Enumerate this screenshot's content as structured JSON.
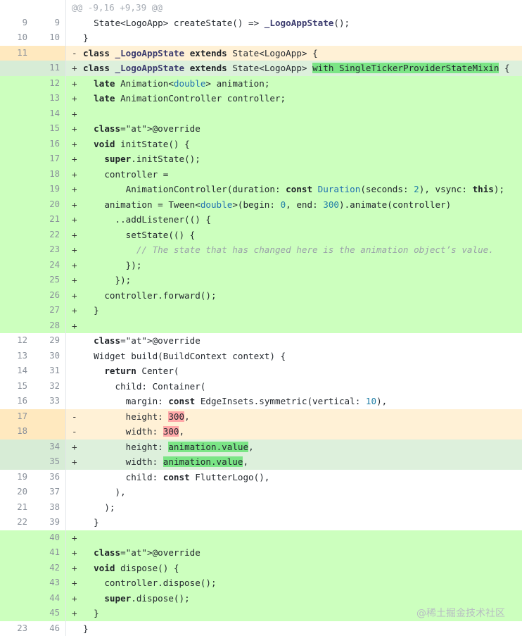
{
  "hunk_header": "@@ -9,16 +9,39 @@",
  "lines": [
    {
      "old": "9",
      "new": "9",
      "sign": "",
      "code": "  State<LogoApp> createState() => _LogoAppState();"
    },
    {
      "old": "10",
      "new": "10",
      "sign": "",
      "code": "}"
    },
    {
      "old": "11",
      "new": "",
      "sign": "-",
      "code": "class _LogoAppState extends State<LogoApp> {"
    },
    {
      "old": "",
      "new": "11",
      "sign": "+",
      "code": "class _LogoAppState extends State<LogoApp> with SingleTickerProviderStateMixin {"
    },
    {
      "old": "",
      "new": "12",
      "sign": "+",
      "code": "  late Animation<double> animation;"
    },
    {
      "old": "",
      "new": "13",
      "sign": "+",
      "code": "  late AnimationController controller;"
    },
    {
      "old": "",
      "new": "14",
      "sign": "+",
      "code": ""
    },
    {
      "old": "",
      "new": "15",
      "sign": "+",
      "code": "  @override"
    },
    {
      "old": "",
      "new": "16",
      "sign": "+",
      "code": "  void initState() {"
    },
    {
      "old": "",
      "new": "17",
      "sign": "+",
      "code": "    super.initState();"
    },
    {
      "old": "",
      "new": "18",
      "sign": "+",
      "code": "    controller ="
    },
    {
      "old": "",
      "new": "19",
      "sign": "+",
      "code": "        AnimationController(duration: const Duration(seconds: 2), vsync: this);"
    },
    {
      "old": "",
      "new": "20",
      "sign": "+",
      "code": "    animation = Tween<double>(begin: 0, end: 300).animate(controller)"
    },
    {
      "old": "",
      "new": "21",
      "sign": "+",
      "code": "      ..addListener(() {"
    },
    {
      "old": "",
      "new": "22",
      "sign": "+",
      "code": "        setState(() {"
    },
    {
      "old": "",
      "new": "23",
      "sign": "+",
      "code": "          // The state that has changed here is the animation object’s value."
    },
    {
      "old": "",
      "new": "24",
      "sign": "+",
      "code": "        });"
    },
    {
      "old": "",
      "new": "25",
      "sign": "+",
      "code": "      });"
    },
    {
      "old": "",
      "new": "26",
      "sign": "+",
      "code": "    controller.forward();"
    },
    {
      "old": "",
      "new": "27",
      "sign": "+",
      "code": "  }"
    },
    {
      "old": "",
      "new": "28",
      "sign": "+",
      "code": ""
    },
    {
      "old": "12",
      "new": "29",
      "sign": "",
      "code": "  @override"
    },
    {
      "old": "13",
      "new": "30",
      "sign": "",
      "code": "  Widget build(BuildContext context) {"
    },
    {
      "old": "14",
      "new": "31",
      "sign": "",
      "code": "    return Center("
    },
    {
      "old": "15",
      "new": "32",
      "sign": "",
      "code": "      child: Container("
    },
    {
      "old": "16",
      "new": "33",
      "sign": "",
      "code": "        margin: const EdgeInsets.symmetric(vertical: 10),"
    },
    {
      "old": "17",
      "new": "",
      "sign": "-",
      "code": "        height: 300,"
    },
    {
      "old": "18",
      "new": "",
      "sign": "-",
      "code": "        width: 300,"
    },
    {
      "old": "",
      "new": "34",
      "sign": "+",
      "code": "        height: animation.value,"
    },
    {
      "old": "",
      "new": "35",
      "sign": "+",
      "code": "        width: animation.value,"
    },
    {
      "old": "19",
      "new": "36",
      "sign": "",
      "code": "        child: const FlutterLogo(),"
    },
    {
      "old": "20",
      "new": "37",
      "sign": "",
      "code": "      ),"
    },
    {
      "old": "21",
      "new": "38",
      "sign": "",
      "code": "    );"
    },
    {
      "old": "22",
      "new": "39",
      "sign": "",
      "code": "  }"
    },
    {
      "old": "",
      "new": "40",
      "sign": "+",
      "code": ""
    },
    {
      "old": "",
      "new": "41",
      "sign": "+",
      "code": "  @override"
    },
    {
      "old": "",
      "new": "42",
      "sign": "+",
      "code": "  void dispose() {"
    },
    {
      "old": "",
      "new": "43",
      "sign": "+",
      "code": "    controller.dispose();"
    },
    {
      "old": "",
      "new": "44",
      "sign": "+",
      "code": "    super.dispose();"
    },
    {
      "old": "",
      "new": "45",
      "sign": "+",
      "code": "  }"
    },
    {
      "old": "23",
      "new": "46",
      "sign": "",
      "code": "}"
    }
  ],
  "watermark": "@稀土掘金技术社区",
  "colors": {
    "added_bg": "#ccffbe",
    "removed_bg": "#fff1d6",
    "modified_added_bg": "#ddf0dc",
    "word_added_hl": "#7be586",
    "word_removed_hl": "#ffa8a8"
  }
}
